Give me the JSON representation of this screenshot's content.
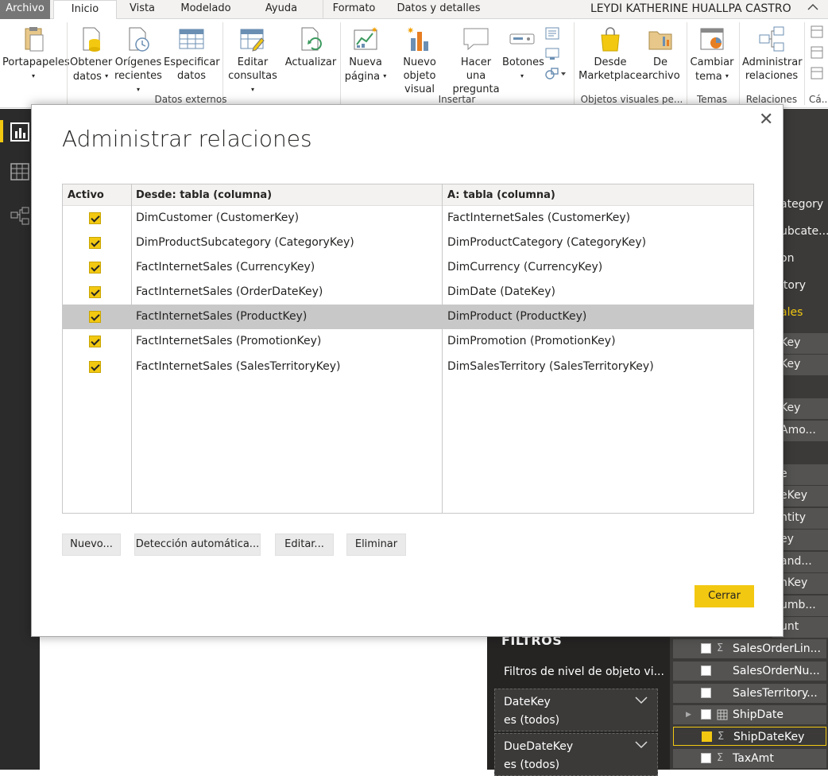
{
  "tabs": {
    "file": "Archivo",
    "home": "Inicio",
    "view": "Vista",
    "modeling": "Modelado",
    "help": "Ayuda",
    "format": "Formato",
    "data_details": "Datos y detalles"
  },
  "user_name": "LEYDI KATHERINE HUALLPA CASTRO",
  "ribbon": {
    "clipboard": "Portapapeles",
    "get_data_1": "Obtener",
    "get_data_2": "datos",
    "recent_1": "Orígenes",
    "recent_2": "recientes",
    "specify_1": "Especificar",
    "specify_2": "datos",
    "edit_q_1": "Editar",
    "edit_q_2": "consultas",
    "refresh": "Actualizar",
    "new_page_1": "Nueva",
    "new_page_2": "página",
    "new_visual_1": "Nuevo",
    "new_visual_2": "objeto visual",
    "ask_1": "Hacer una",
    "ask_2": "pregunta",
    "buttons": "Botones",
    "marketplace_1": "Desde",
    "marketplace_2": "Marketplace",
    "from_file_1": "De",
    "from_file_2": "archivo",
    "theme_1": "Cambiar",
    "theme_2": "tema",
    "manage_rel_1": "Administrar",
    "manage_rel_2": "relaciones",
    "groups": {
      "external": "Datos externos",
      "insert": "Insertar",
      "visuals": "Objetos visuales pe...",
      "themes": "Temas",
      "relations": "Relaciones",
      "calc": "Cá..."
    }
  },
  "dialog": {
    "title": "Administrar relaciones",
    "columns": {
      "active": "Activo",
      "from": "Desde: tabla (columna)",
      "to": "A: tabla (columna)"
    },
    "rows": [
      {
        "from": "DimCustomer (CustomerKey)",
        "to": "FactInternetSales (CustomerKey)"
      },
      {
        "from": "DimProductSubcategory (CategoryKey)",
        "to": "DimProductCategory (CategoryKey)"
      },
      {
        "from": "FactInternetSales (CurrencyKey)",
        "to": "DimCurrency (CurrencyKey)"
      },
      {
        "from": "FactInternetSales (OrderDateKey)",
        "to": "DimDate (DateKey)"
      },
      {
        "from": "FactInternetSales (ProductKey)",
        "to": "DimProduct (ProductKey)"
      },
      {
        "from": "FactInternetSales (PromotionKey)",
        "to": "DimPromotion (PromotionKey)"
      },
      {
        "from": "FactInternetSales (SalesTerritoryKey)",
        "to": "DimSalesTerritory (SalesTerritoryKey)"
      }
    ],
    "buttons": {
      "new": "Nuevo...",
      "autodetect": "Detección automática...",
      "edit": "Editar...",
      "delete": "Eliminar",
      "close": "Cerrar"
    },
    "close_glyph": "✕"
  },
  "fields_partial": [
    "ategory",
    "ubcate...",
    "on",
    "itory",
    "ales",
    "Key",
    "Key",
    "",
    "Key",
    "Amo...",
    "",
    "e",
    "eKey",
    "ntity",
    "ey",
    "and...",
    "nKey",
    "umb...",
    "unt"
  ],
  "fields": [
    {
      "name": "SalesOrderLin...",
      "sigma": "Σ",
      "checked": false
    },
    {
      "name": "SalesOrderNu...",
      "sigma": "",
      "checked": false
    },
    {
      "name": "SalesTerritory...",
      "sigma": "",
      "checked": false
    },
    {
      "name": "ShipDate",
      "sigma": "",
      "checked": false
    },
    {
      "name": "ShipDateKey",
      "sigma": "Σ",
      "checked": true
    },
    {
      "name": "TaxAmt",
      "sigma": "Σ",
      "checked": false
    }
  ],
  "filters": {
    "title": "FILTROS",
    "level": "Filtros de nivel de objeto vi...",
    "cards": [
      {
        "field": "DateKey",
        "value": "es (todos)"
      },
      {
        "field": "DueDateKey",
        "value": "es (todos)"
      }
    ]
  },
  "colors": {
    "accent": "#f2c811",
    "nav_bg": "#2b2b2b",
    "pane_bg": "#252423"
  }
}
